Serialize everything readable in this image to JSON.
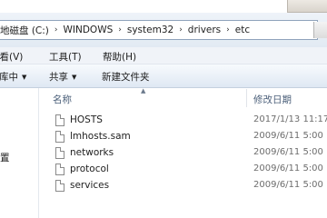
{
  "address": {
    "crumbs": [
      "地磁盘 (C:)",
      "WINDOWS",
      "system32",
      "drivers",
      "etc"
    ],
    "separator": "›"
  },
  "menu": {
    "items": [
      "查看(V)",
      "工具(T)",
      "帮助(H)"
    ]
  },
  "commands": {
    "organize": "库中",
    "share": "共享",
    "new_folder": "新建文件夹"
  },
  "nav": {
    "partial_item": "置"
  },
  "columns": {
    "name": "名称",
    "modified": "修改日期"
  },
  "files": [
    {
      "name": "HOSTS",
      "modified": "2017/1/13 11:17"
    },
    {
      "name": "lmhosts.sam",
      "modified": "2009/6/11 5:00"
    },
    {
      "name": "networks",
      "modified": "2009/6/11 5:00"
    },
    {
      "name": "protocol",
      "modified": "2009/6/11 5:00"
    },
    {
      "name": "services",
      "modified": "2009/6/11 5:00"
    }
  ]
}
